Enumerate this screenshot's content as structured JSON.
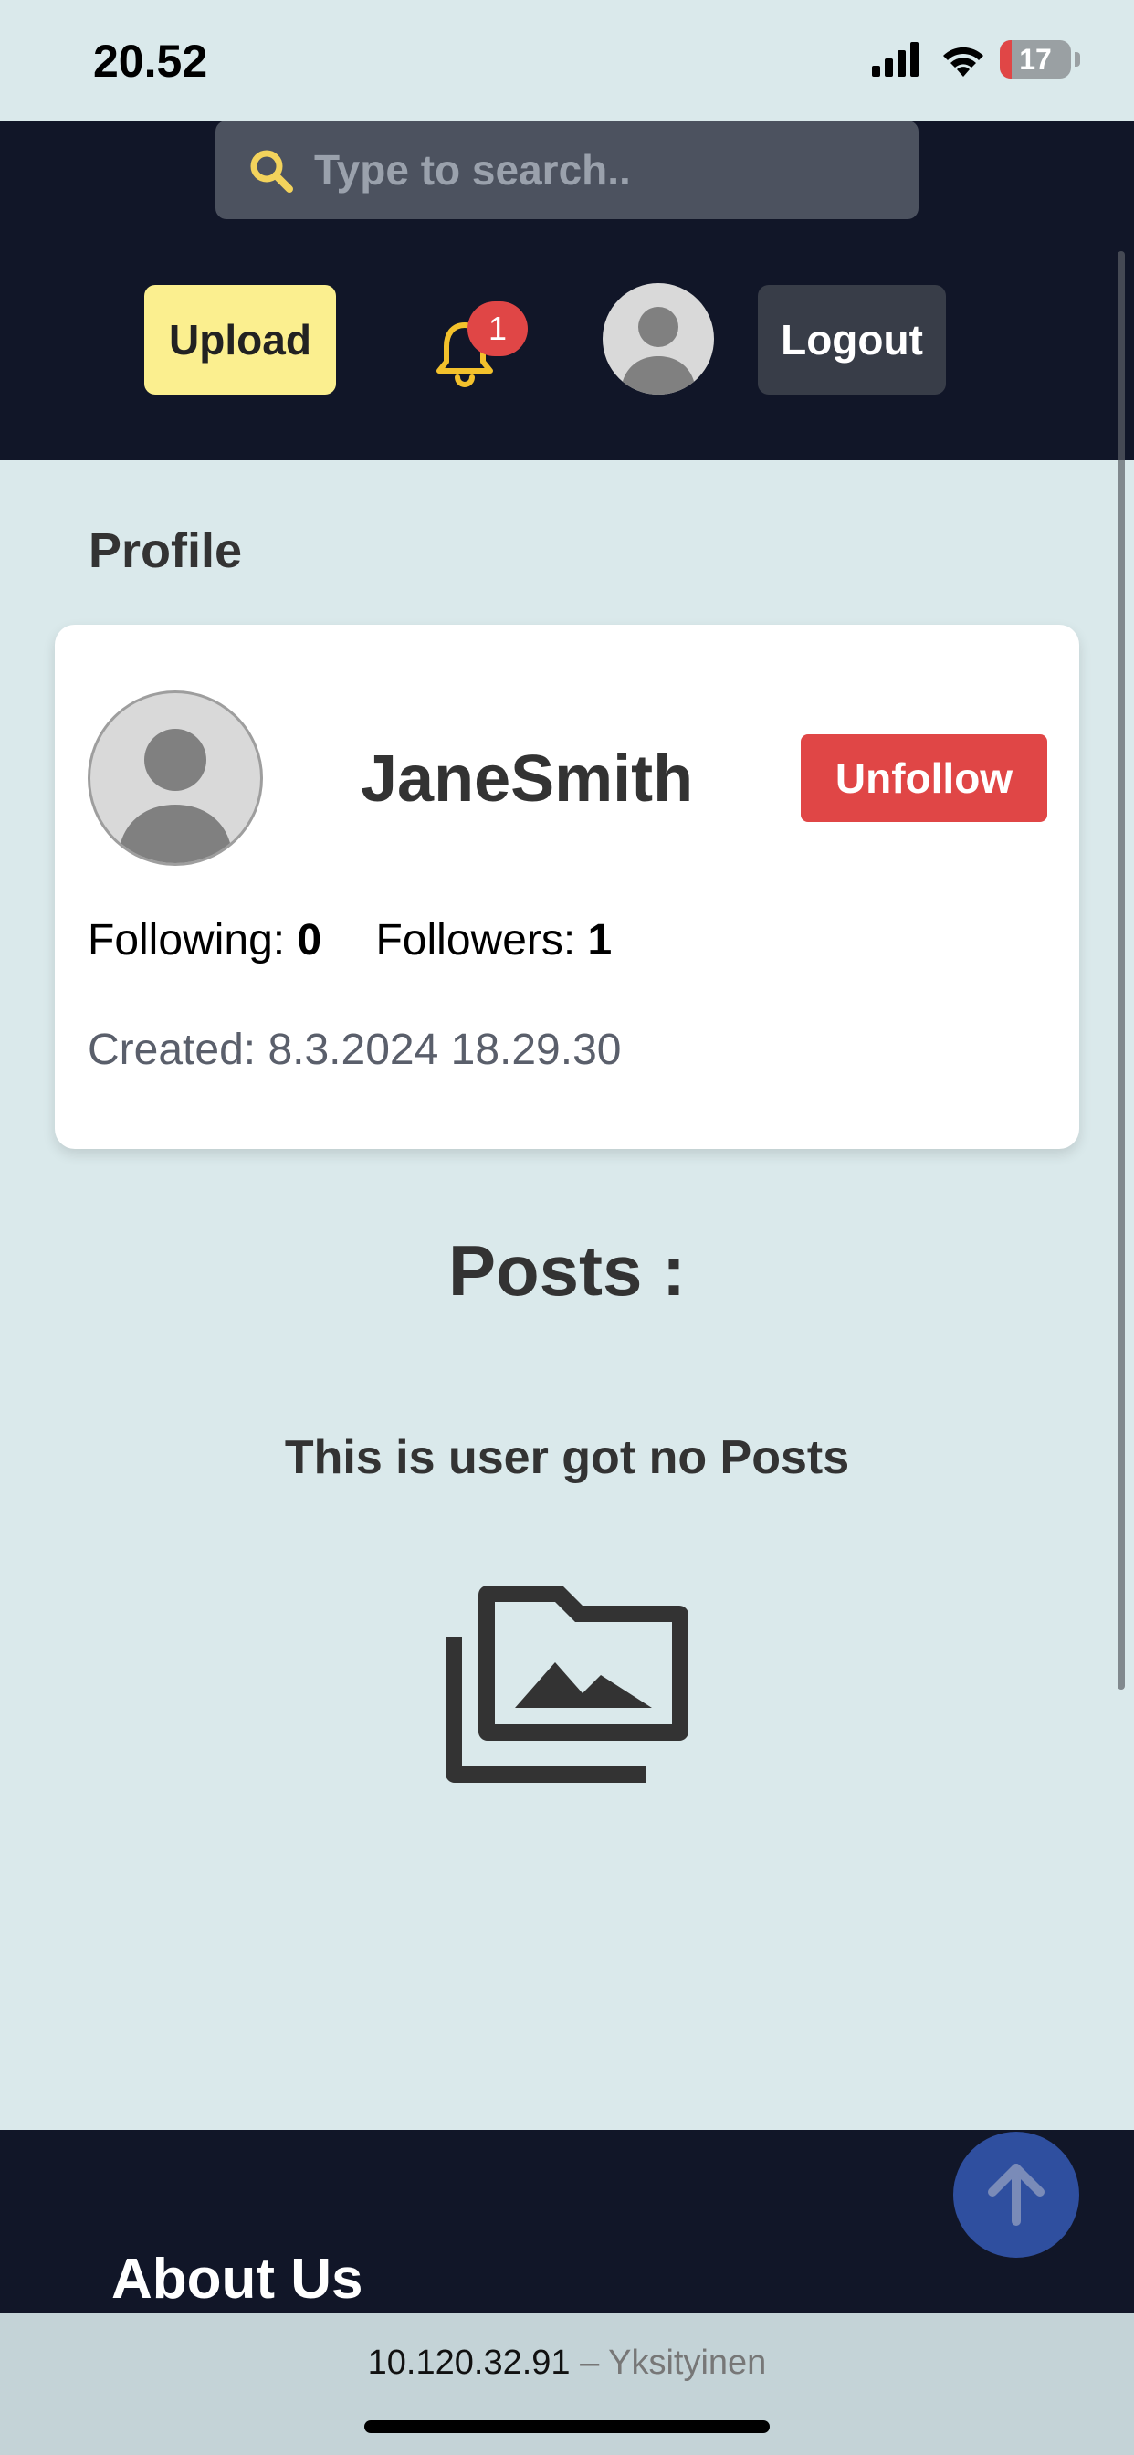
{
  "status_bar": {
    "time": "20.52",
    "battery_level": "17",
    "battery_fraction": 0.17
  },
  "header": {
    "search": {
      "placeholder": "Type to search..",
      "icon": "search-icon"
    },
    "upload_label": "Upload",
    "notification_count": "1",
    "logout_label": "Logout"
  },
  "profile": {
    "section_title": "Profile",
    "username": "JaneSmith",
    "action_label": "Unfollow",
    "following_label": "Following:",
    "following_value": "0",
    "followers_label": "Followers:",
    "followers_value": "1",
    "created_text": "Created: 8.3.2024 18.29.30"
  },
  "posts": {
    "heading": "Posts :",
    "empty_message": "This is user got no Posts",
    "empty_icon": "photo-folder-icon"
  },
  "footer": {
    "title": "About Us"
  },
  "browser": {
    "address": "10.120.32.91",
    "separator": "–",
    "mode": "Yksityinen"
  },
  "colors": {
    "page_background": "#dae9eb",
    "header_background": "#111628",
    "upload_button": "#fbef8f",
    "unfollow_button": "#e04646",
    "notification_badge": "#e04646",
    "bell": "#f3c12c",
    "scroll_top_button": "#2f4f9f"
  }
}
